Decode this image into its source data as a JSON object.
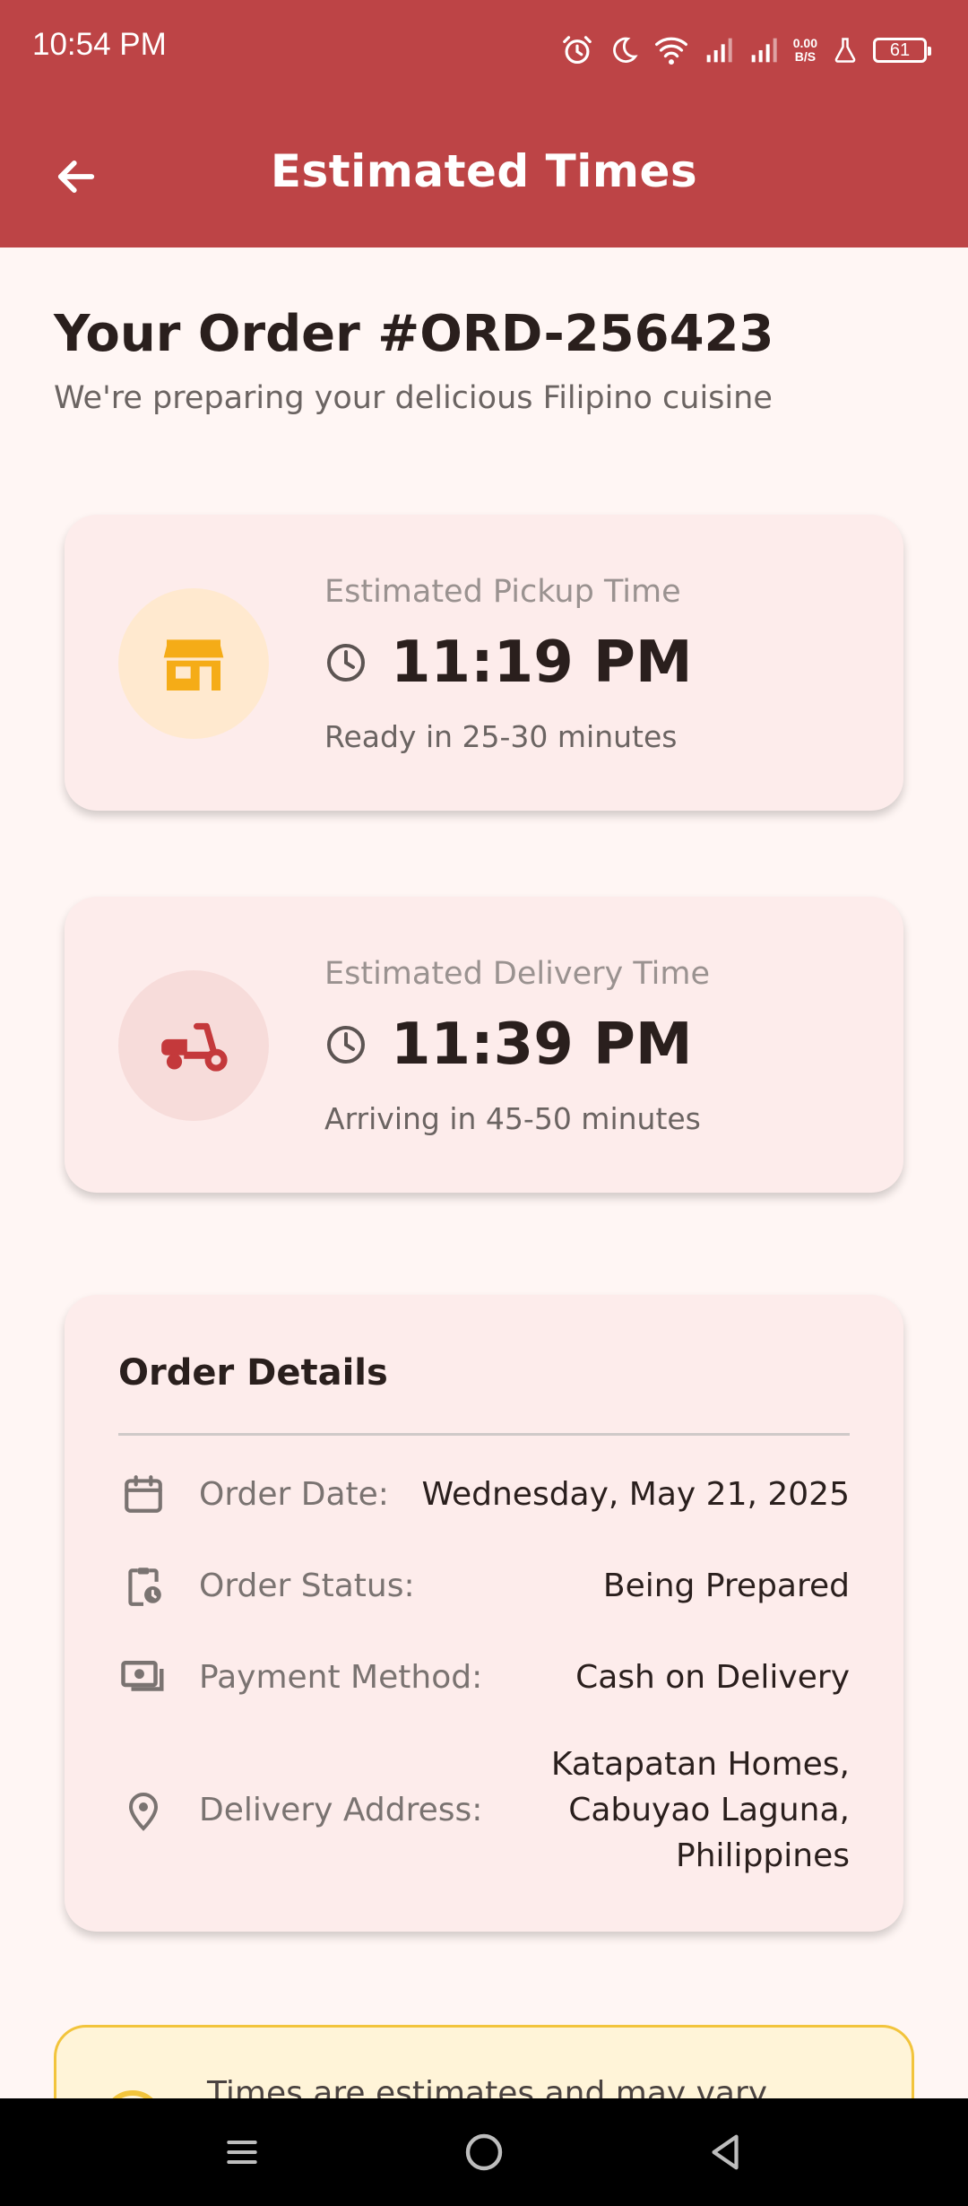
{
  "status_bar": {
    "time": "10:54 PM",
    "net_speed_value": "0.00",
    "net_speed_unit": "B/S",
    "battery": "61",
    "icons": [
      "alarm-icon",
      "moon-icon",
      "wifi-icon",
      "signal-icon",
      "signal-icon",
      "flask-icon",
      "battery-icon"
    ]
  },
  "app_bar": {
    "title": "Estimated Times",
    "back_icon": "arrow-left-icon"
  },
  "order": {
    "heading": "Your Order #ORD-256423",
    "subtitle": "We're preparing your delicious Filipino cuisine"
  },
  "pickup": {
    "label": "Estimated Pickup Time",
    "time": "11:19 PM",
    "note": "Ready in 25-30 minutes",
    "icon": "store-icon",
    "icon_color": "#f5ac17",
    "circle_color": "#ffe9cf"
  },
  "delivery": {
    "label": "Estimated Delivery Time",
    "time": "11:39 PM",
    "note": "Arriving in 45-50 minutes",
    "icon": "scooter-icon",
    "icon_color": "#c4393b",
    "circle_color": "#f7dcda"
  },
  "details": {
    "title": "Order Details",
    "rows": [
      {
        "icon": "calendar-icon",
        "label": "Order Date:",
        "value": "Wednesday, May 21, 2025"
      },
      {
        "icon": "clipboard-clock-icon",
        "label": "Order Status:",
        "value": "Being Prepared"
      },
      {
        "icon": "cash-icon",
        "label": "Payment Method:",
        "value": "Cash on Delivery"
      },
      {
        "icon": "location-pin-icon",
        "label": "Delivery Address:",
        "value_lines": [
          "Katapatan Homes,",
          "Cabuyao Laguna,",
          "Philippines"
        ]
      }
    ]
  },
  "notice": {
    "text": "Times are estimates and may vary based"
  },
  "nav_bar": {
    "icons": [
      "menu-icon",
      "home-circle-icon",
      "back-triangle-icon"
    ]
  },
  "colors": {
    "primary": "#bd4446",
    "background": "#fff6f4",
    "card": "#fdeceb",
    "notice_border": "#f2c43c"
  }
}
